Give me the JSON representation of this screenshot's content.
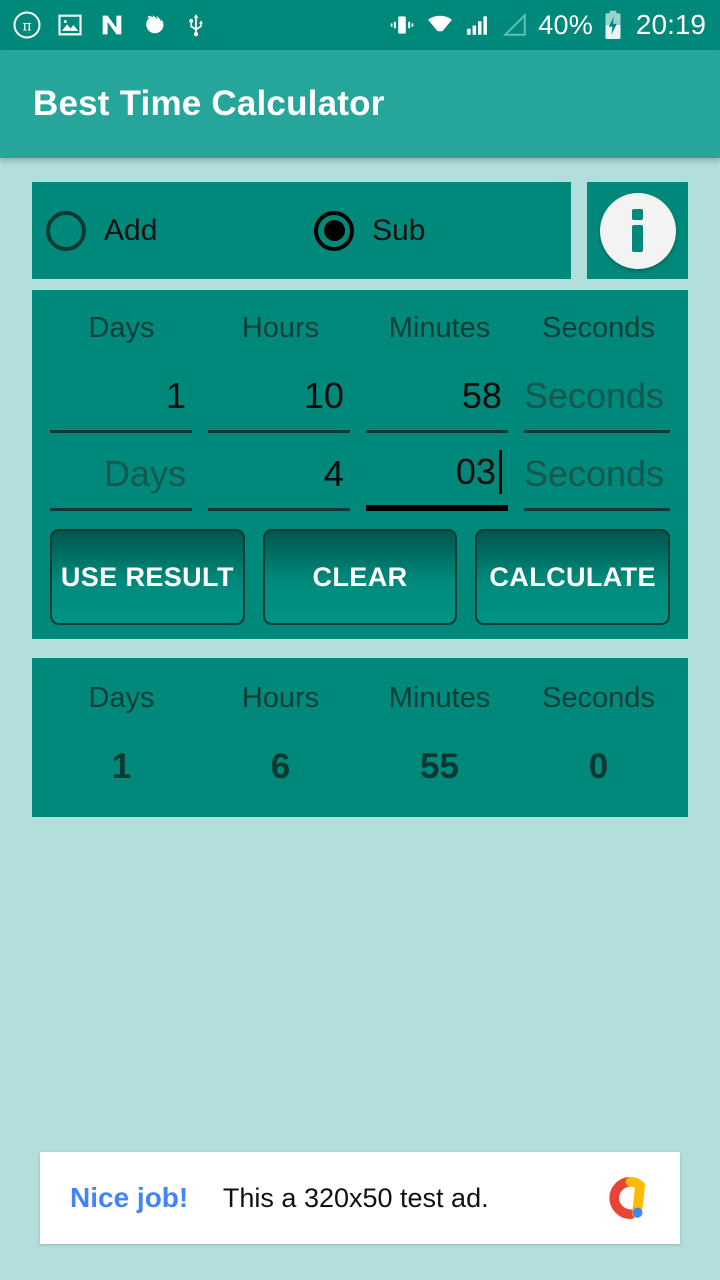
{
  "statusbar": {
    "left_icons": [
      "pi-circle-icon",
      "image-icon",
      "letter-n-icon",
      "firefox-icon",
      "usb-icon"
    ],
    "right_icons": [
      "vibrate-icon",
      "wifi-icon",
      "signal-bars-icon",
      "signal-empty-icon"
    ],
    "battery_percent": "40%",
    "battery_icon": "battery-charging-icon",
    "clock": "20:19"
  },
  "appbar": {
    "title": "Best Time Calculator"
  },
  "mode": {
    "add_label": "Add",
    "sub_label": "Sub",
    "add_selected": false,
    "sub_selected": true,
    "info_icon": "info-icon"
  },
  "input": {
    "headers": [
      "Days",
      "Hours",
      "Minutes",
      "Seconds"
    ],
    "row1": [
      {
        "value": "1",
        "placeholder": "Days",
        "focused": false
      },
      {
        "value": "10",
        "placeholder": "Hours",
        "focused": false
      },
      {
        "value": "58",
        "placeholder": "Minutes",
        "focused": false
      },
      {
        "value": "",
        "placeholder": "Seconds",
        "focused": false
      }
    ],
    "row2": [
      {
        "value": "",
        "placeholder": "Days",
        "focused": false
      },
      {
        "value": "4",
        "placeholder": "Hours",
        "focused": false
      },
      {
        "value": "03",
        "placeholder": "Minutes",
        "focused": true
      },
      {
        "value": "",
        "placeholder": "Seconds",
        "focused": false
      }
    ]
  },
  "buttons": {
    "use_result": "USE RESULT",
    "clear": "CLEAR",
    "calculate": "CALCULATE"
  },
  "result": {
    "headers": [
      "Days",
      "Hours",
      "Minutes",
      "Seconds"
    ],
    "values": [
      "1",
      "6",
      "55",
      "0"
    ]
  },
  "ad": {
    "link_text": "Nice job!",
    "body_text": "This a 320x50 test ad.",
    "logo_icon": "admob-logo-icon"
  },
  "colors": {
    "background": "#b2dfdb",
    "panel": "#00897b",
    "appbar": "#26a69a",
    "statusbar": "#00897b",
    "ad_link": "#4285f4"
  }
}
